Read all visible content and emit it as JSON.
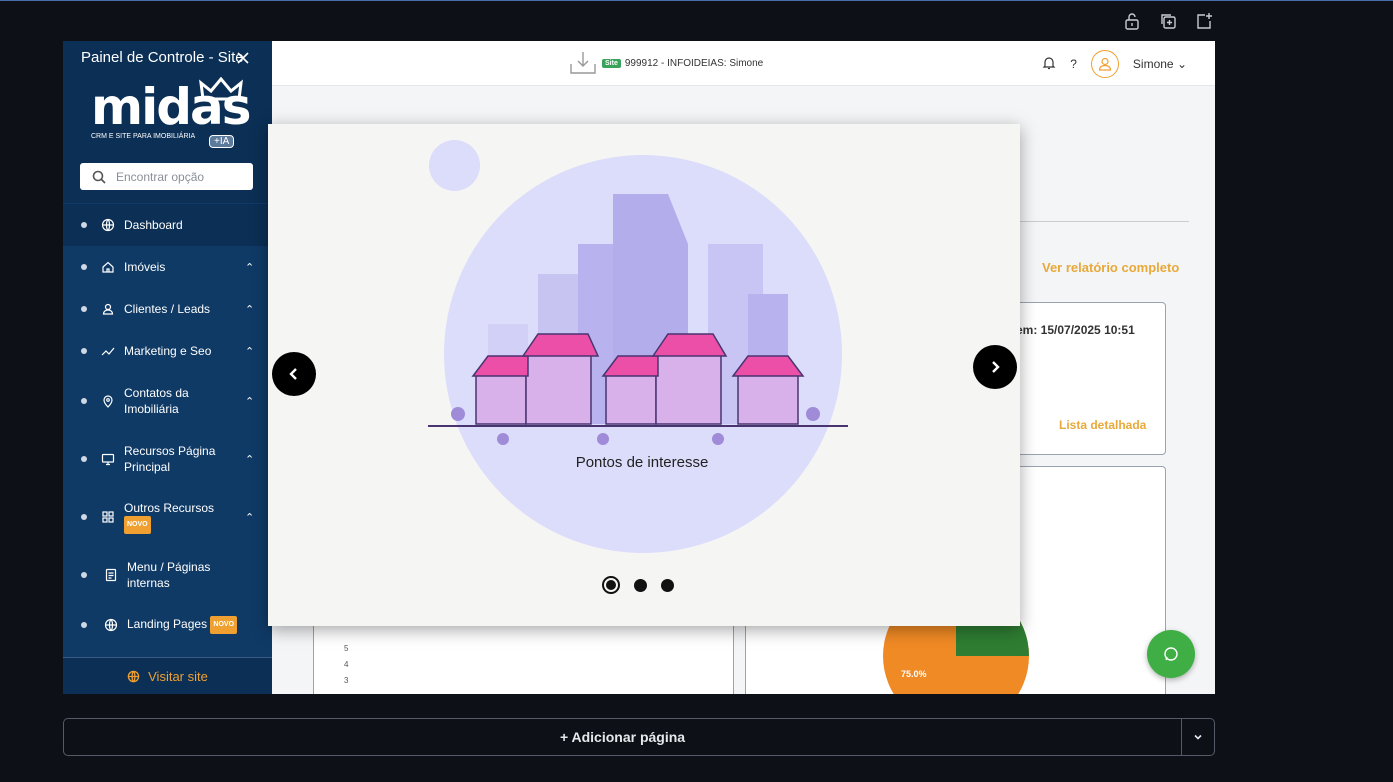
{
  "sidebar": {
    "title": "Painel de Controle - Site",
    "logo_text": "midas",
    "logo_subtitle": "CRM E SITE PARA IMOBILIÁRIA",
    "logo_badge": "+IA",
    "search_placeholder": "Encontrar opção",
    "items": [
      {
        "label": "Dashboard",
        "icon": "globe-icon"
      },
      {
        "label": "Imóveis",
        "icon": "home-icon"
      },
      {
        "label": "Clientes / Leads",
        "icon": "user-icon"
      },
      {
        "label": "Marketing e Seo",
        "icon": "chart-line-icon"
      },
      {
        "label": "Contatos da Imobiliária",
        "icon": "location-pin-icon"
      },
      {
        "label": "Recursos Página Principal",
        "icon": "monitor-icon"
      },
      {
        "label": "Outros Recursos",
        "icon": "grid-icon",
        "badge": "NOVO"
      },
      {
        "label": "Menu / Páginas internas",
        "icon": "document-icon"
      },
      {
        "label": "Landing Pages",
        "icon": "globe-icon",
        "badge": "NOVO"
      }
    ],
    "visit_site": "Visitar site"
  },
  "header": {
    "site_tag": "Site",
    "site_info": "999912 - INFOIDEIAS: Simone",
    "help": "?",
    "user_name": "Simone"
  },
  "background": {
    "ver_relatorio": "Ver relatório completo",
    "updated_text": "em: 15/07/2025 10:51",
    "lista_detalhada": "Lista detalhada",
    "axis_ticks": [
      "5",
      "4",
      "3"
    ],
    "pie_label": "75.0%"
  },
  "modal": {
    "caption": "Pontos de interesse",
    "slide_count": 3,
    "active_slide": 1
  },
  "footer": {
    "add_page": "+ Adicionar página"
  },
  "colors": {
    "sidebar_bg": "#0f3a66",
    "accent_orange": "#e8a93a",
    "whatsapp_green": "#3fae45"
  }
}
